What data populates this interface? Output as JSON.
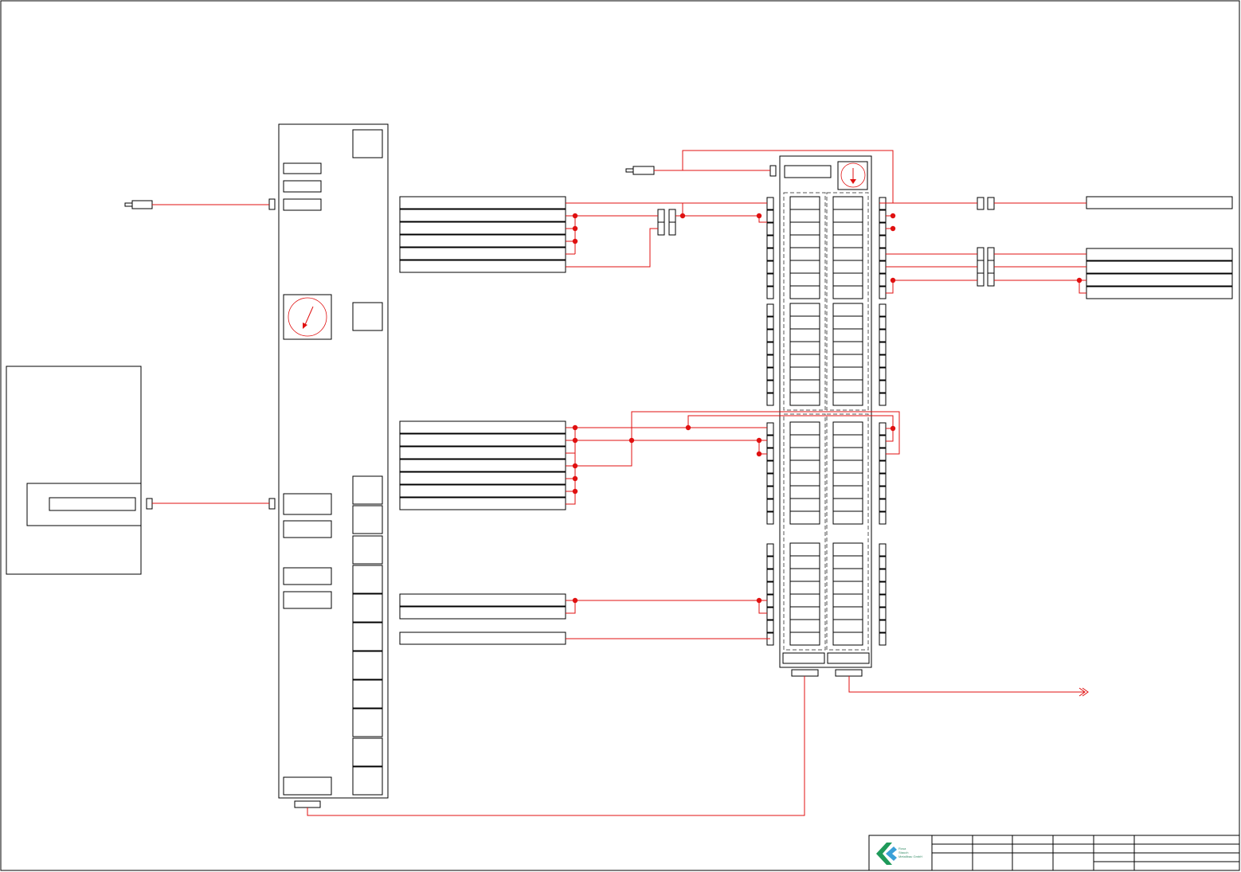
{
  "drawing": {
    "line_color": "#e01010",
    "outline_color": "#000000",
    "background": "#ffffff"
  },
  "title_block": {
    "logo_lines": [
      "Rosa",
      "Stauch",
      "Metallbau GmbH"
    ],
    "logo_colors": [
      "#1f9a5a",
      "#3aa0d8",
      "#2b6cb0"
    ]
  },
  "icons": {
    "gauge_left": "analog-gauge-icon",
    "gauge_right": "analog-gauge-icon",
    "output_arrow": "double-arrow-icon",
    "plug_left": "connector-plug-icon",
    "plug_top": "connector-plug-icon"
  }
}
